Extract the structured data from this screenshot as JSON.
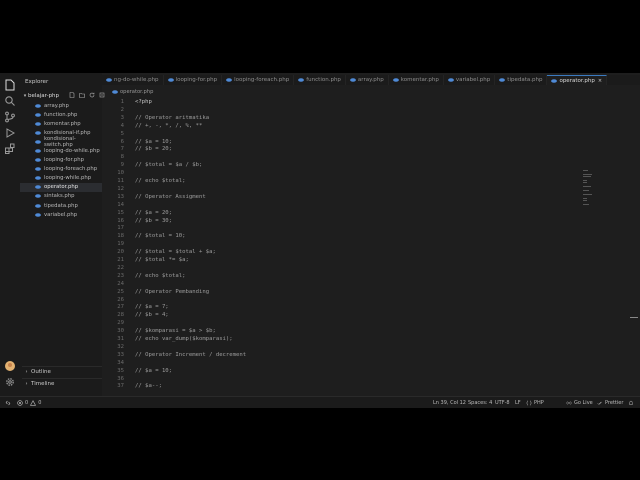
{
  "sidebar": {
    "title": "Explorer",
    "folder": "belajar-php",
    "files": [
      {
        "name": "array.php",
        "selected": false
      },
      {
        "name": "function.php",
        "selected": false
      },
      {
        "name": "komentar.php",
        "selected": false
      },
      {
        "name": "kondisional-if.php",
        "selected": false
      },
      {
        "name": "kondisional-switch.php",
        "selected": false
      },
      {
        "name": "looping-do-while.php",
        "selected": false
      },
      {
        "name": "looping-for.php",
        "selected": false
      },
      {
        "name": "looping-foreach.php",
        "selected": false
      },
      {
        "name": "looping-while.php",
        "selected": false
      },
      {
        "name": "operator.php",
        "selected": true
      },
      {
        "name": "sintaks.php",
        "selected": false
      },
      {
        "name": "tipedata.php",
        "selected": false
      },
      {
        "name": "variabel.php",
        "selected": false
      }
    ],
    "outline_label": "Outline",
    "timeline_label": "Timeline"
  },
  "tabs": [
    {
      "label": "ng-do-while.php",
      "active": false
    },
    {
      "label": "looping-for.php",
      "active": false
    },
    {
      "label": "looping-foreach.php",
      "active": false
    },
    {
      "label": "function.php",
      "active": false
    },
    {
      "label": "array.php",
      "active": false
    },
    {
      "label": "komentar.php",
      "active": false
    },
    {
      "label": "variabel.php",
      "active": false
    },
    {
      "label": "tipedata.php",
      "active": false
    },
    {
      "label": "operator.php",
      "active": true
    }
  ],
  "breadcrumb": "operator.php",
  "editor": {
    "lines": [
      {
        "n": "1",
        "t": "<?php"
      },
      {
        "n": "2",
        "t": ""
      },
      {
        "n": "3",
        "t": "// Operator aritmatika"
      },
      {
        "n": "4",
        "t": "// +, -, *, /, %, **"
      },
      {
        "n": "5",
        "t": ""
      },
      {
        "n": "6",
        "t": "// $a = 10;"
      },
      {
        "n": "7",
        "t": "// $b = 20;"
      },
      {
        "n": "8",
        "t": ""
      },
      {
        "n": "9",
        "t": "// $total = $a / $b;"
      },
      {
        "n": "10",
        "t": ""
      },
      {
        "n": "11",
        "t": "// echo $total;"
      },
      {
        "n": "12",
        "t": ""
      },
      {
        "n": "13",
        "t": "// Operator Assigment"
      },
      {
        "n": "14",
        "t": ""
      },
      {
        "n": "15",
        "t": "// $a = 20;"
      },
      {
        "n": "16",
        "t": "// $b = 30;"
      },
      {
        "n": "17",
        "t": ""
      },
      {
        "n": "18",
        "t": "// $total = 10;"
      },
      {
        "n": "19",
        "t": ""
      },
      {
        "n": "20",
        "t": "// $total = $total + $a;"
      },
      {
        "n": "21",
        "t": "// $total *= $a;"
      },
      {
        "n": "22",
        "t": ""
      },
      {
        "n": "23",
        "t": "// echo $total;"
      },
      {
        "n": "24",
        "t": ""
      },
      {
        "n": "25",
        "t": "// Operator Pembanding"
      },
      {
        "n": "26",
        "t": ""
      },
      {
        "n": "27",
        "t": "// $a = 7;"
      },
      {
        "n": "28",
        "t": "// $b = 4;"
      },
      {
        "n": "29",
        "t": ""
      },
      {
        "n": "30",
        "t": "// $komparasi = $a > $b;"
      },
      {
        "n": "31",
        "t": "// echo var_dump($komparasi);"
      },
      {
        "n": "32",
        "t": ""
      },
      {
        "n": "33",
        "t": "// Operator Increment / decrement"
      },
      {
        "n": "34",
        "t": ""
      },
      {
        "n": "35",
        "t": "// $a = 10;"
      },
      {
        "n": "36",
        "t": ""
      },
      {
        "n": "37",
        "t": "// $a--;"
      }
    ]
  },
  "status": {
    "errors": "0",
    "warnings": "0",
    "position": "Ln 39, Col 12",
    "spaces": "Spaces: 4",
    "encoding": "UTF-8",
    "eol": "LF",
    "language": "PHP",
    "golive": "Go Live",
    "prettier": "Prettier"
  },
  "colors": {
    "accent": "#3a7ac0",
    "php_icon": "#4f8ad6",
    "background": "#1e1e1e"
  }
}
